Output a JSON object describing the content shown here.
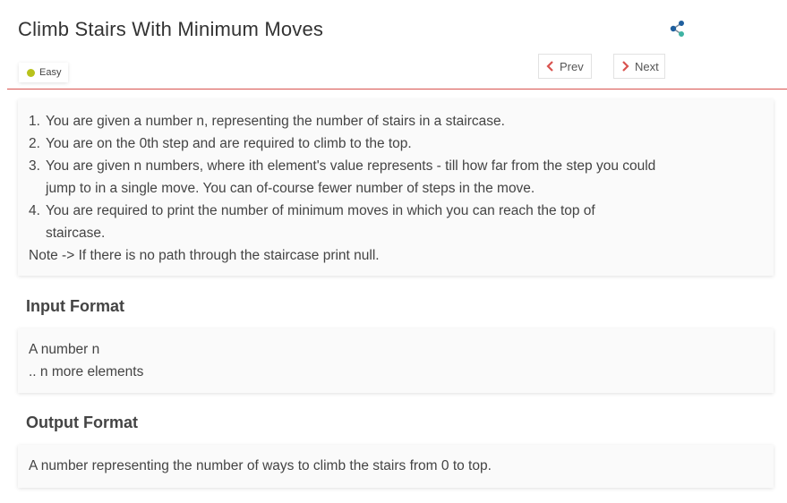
{
  "header": {
    "title": "Climb Stairs With Minimum Moves",
    "difficulty": "Easy",
    "prev_label": "Prev",
    "next_label": "Next"
  },
  "colors": {
    "accent_rule": "#d9534f",
    "difficulty_dot": "#b8c21c",
    "nav_chevron": "#d9534f",
    "share_blue": "#1f5f9e",
    "share_teal": "#3fb3a3"
  },
  "icons": {
    "share": "share-icon",
    "prev": "chevron-left-icon",
    "next": "chevron-right-icon"
  },
  "description": {
    "items": [
      {
        "num": "1.",
        "text": "You are given a number n, representing the number of stairs in a staircase."
      },
      {
        "num": "2.",
        "text": "You are on the 0th step and are required to climb to the top."
      },
      {
        "num": "3.",
        "text": "You are given n numbers, where ith element's value represents - till how far from the step you could jump to in a single move.  You can of-course fewer number of steps in the move."
      },
      {
        "num": "4.",
        "text": "You are required to print the number of minimum moves in which you can reach the top of staircase."
      }
    ],
    "note": "Note -> If there is no path through the staircase print null."
  },
  "input_format": {
    "title": "Input Format",
    "lines": [
      "A number n",
      ".. n more elements"
    ]
  },
  "output_format": {
    "title": "Output Format",
    "lines": [
      "A number representing the number of ways to climb the stairs from 0 to top."
    ]
  }
}
